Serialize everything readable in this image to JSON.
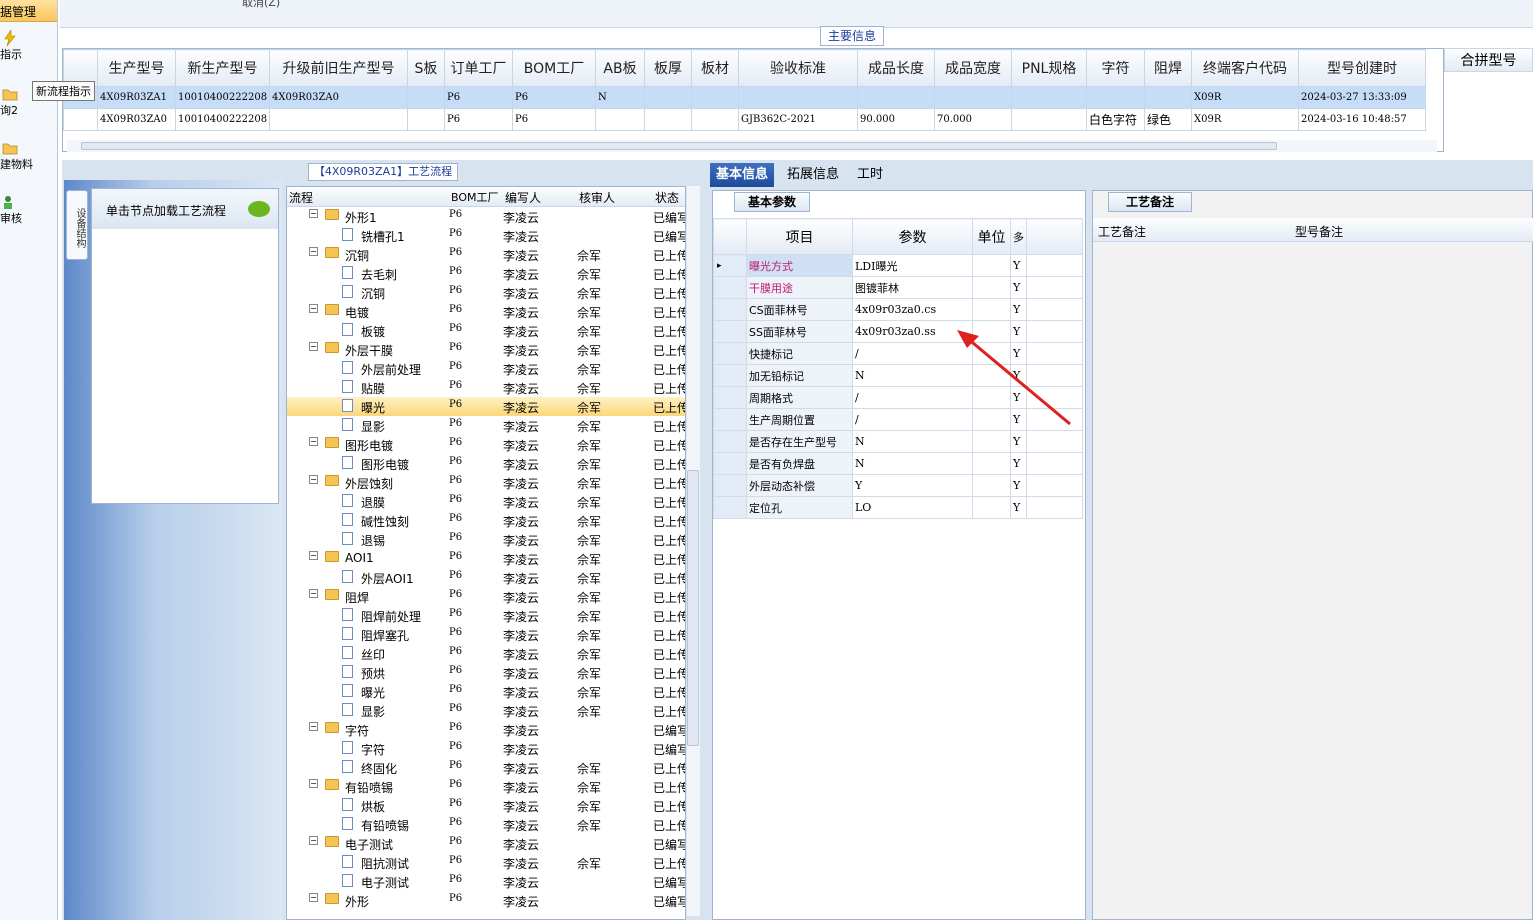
{
  "nav": {
    "header": "据管理",
    "items": [
      {
        "label": "指示",
        "icon": "lightning-icon"
      },
      {
        "label": "询2",
        "icon": "folder-icon"
      },
      {
        "label": "建物料",
        "icon": "folder-icon"
      },
      {
        "label": "审核",
        "icon": "users-icon"
      }
    ],
    "tooltip": "新流程指示"
  },
  "top": {
    "cancel": "取消(Z)"
  },
  "main_info": {
    "legend": "主要信息",
    "columns": [
      "生产型号",
      "新生产型号",
      "升级前旧生产型号",
      "S板",
      "订单工厂",
      "BOM工厂",
      "AB板",
      "板厚",
      "板材",
      "验收标准",
      "成品长度",
      "成品宽度",
      "PNL规格",
      "字符",
      "阻焊",
      "终端客户代码",
      "型号创建时"
    ],
    "combine_header": "合拼型号",
    "rows": [
      [
        "4X09R03ZA1",
        "10010400222208",
        "4X09R03ZA0",
        "",
        "P6",
        "P6",
        "N",
        "",
        "",
        "",
        "",
        "",
        "",
        "",
        "",
        "X09R",
        "2024-03-27 13:33:09"
      ],
      [
        "4X09R03ZA0",
        "10010400222208",
        "",
        "",
        "P6",
        "P6",
        "",
        "",
        "",
        "GJB362C-2021",
        "90.000",
        "70.000",
        "",
        "白色字符",
        "绿色",
        "X09R",
        "2024-03-16 10:48:57"
      ]
    ]
  },
  "left_panel": {
    "vtab": "设备结构",
    "load_hint": "单击节点加载工艺流程"
  },
  "tree": {
    "title": "【4X09R03ZA1】工艺流程",
    "columns": [
      "流程",
      "BOM工厂",
      "编写人",
      "核审人",
      "状态"
    ],
    "rows": [
      {
        "lvl": 0,
        "label": "外形1",
        "bom": "P6",
        "writer": "李凌云",
        "reviewer": "",
        "status": "已编写"
      },
      {
        "lvl": 1,
        "label": "铣槽孔1",
        "bom": "P6",
        "writer": "李凌云",
        "reviewer": "",
        "status": "已编写"
      },
      {
        "lvl": 0,
        "label": "沉铜",
        "bom": "P6",
        "writer": "李凌云",
        "reviewer": "佘军",
        "status": "已上传"
      },
      {
        "lvl": 1,
        "label": "去毛刺",
        "bom": "P6",
        "writer": "李凌云",
        "reviewer": "佘军",
        "status": "已上传"
      },
      {
        "lvl": 1,
        "label": "沉铜",
        "bom": "P6",
        "writer": "李凌云",
        "reviewer": "佘军",
        "status": "已上传"
      },
      {
        "lvl": 0,
        "label": "电镀",
        "bom": "P6",
        "writer": "李凌云",
        "reviewer": "佘军",
        "status": "已上传"
      },
      {
        "lvl": 1,
        "label": "板镀",
        "bom": "P6",
        "writer": "李凌云",
        "reviewer": "佘军",
        "status": "已上传"
      },
      {
        "lvl": 0,
        "label": "外层干膜",
        "bom": "P6",
        "writer": "李凌云",
        "reviewer": "佘军",
        "status": "已上传"
      },
      {
        "lvl": 1,
        "label": "外层前处理",
        "bom": "P6",
        "writer": "李凌云",
        "reviewer": "佘军",
        "status": "已上传"
      },
      {
        "lvl": 1,
        "label": "贴膜",
        "bom": "P6",
        "writer": "李凌云",
        "reviewer": "佘军",
        "status": "已上传"
      },
      {
        "lvl": 1,
        "label": "曝光",
        "bom": "P6",
        "writer": "李凌云",
        "reviewer": "佘军",
        "status": "已上传",
        "hl": true
      },
      {
        "lvl": 1,
        "label": "显影",
        "bom": "P6",
        "writer": "李凌云",
        "reviewer": "佘军",
        "status": "已上传"
      },
      {
        "lvl": 0,
        "label": "图形电镀",
        "bom": "P6",
        "writer": "李凌云",
        "reviewer": "佘军",
        "status": "已上传"
      },
      {
        "lvl": 1,
        "label": "图形电镀",
        "bom": "P6",
        "writer": "李凌云",
        "reviewer": "佘军",
        "status": "已上传"
      },
      {
        "lvl": 0,
        "label": "外层蚀刻",
        "bom": "P6",
        "writer": "李凌云",
        "reviewer": "佘军",
        "status": "已上传"
      },
      {
        "lvl": 1,
        "label": "退膜",
        "bom": "P6",
        "writer": "李凌云",
        "reviewer": "佘军",
        "status": "已上传"
      },
      {
        "lvl": 1,
        "label": "碱性蚀刻",
        "bom": "P6",
        "writer": "李凌云",
        "reviewer": "佘军",
        "status": "已上传"
      },
      {
        "lvl": 1,
        "label": "退锡",
        "bom": "P6",
        "writer": "李凌云",
        "reviewer": "佘军",
        "status": "已上传"
      },
      {
        "lvl": 0,
        "label": "AOI1",
        "bom": "P6",
        "writer": "李凌云",
        "reviewer": "佘军",
        "status": "已上传"
      },
      {
        "lvl": 1,
        "label": "外层AOI1",
        "bom": "P6",
        "writer": "李凌云",
        "reviewer": "佘军",
        "status": "已上传"
      },
      {
        "lvl": 0,
        "label": "阻焊",
        "bom": "P6",
        "writer": "李凌云",
        "reviewer": "佘军",
        "status": "已上传"
      },
      {
        "lvl": 1,
        "label": "阻焊前处理",
        "bom": "P6",
        "writer": "李凌云",
        "reviewer": "佘军",
        "status": "已上传"
      },
      {
        "lvl": 1,
        "label": "阻焊塞孔",
        "bom": "P6",
        "writer": "李凌云",
        "reviewer": "佘军",
        "status": "已上传"
      },
      {
        "lvl": 1,
        "label": "丝印",
        "bom": "P6",
        "writer": "李凌云",
        "reviewer": "佘军",
        "status": "已上传"
      },
      {
        "lvl": 1,
        "label": "预烘",
        "bom": "P6",
        "writer": "李凌云",
        "reviewer": "佘军",
        "status": "已上传"
      },
      {
        "lvl": 1,
        "label": "曝光",
        "bom": "P6",
        "writer": "李凌云",
        "reviewer": "佘军",
        "status": "已上传"
      },
      {
        "lvl": 1,
        "label": "显影",
        "bom": "P6",
        "writer": "李凌云",
        "reviewer": "佘军",
        "status": "已上传"
      },
      {
        "lvl": 0,
        "label": "字符",
        "bom": "P6",
        "writer": "李凌云",
        "reviewer": "",
        "status": "已编写"
      },
      {
        "lvl": 1,
        "label": "字符",
        "bom": "P6",
        "writer": "李凌云",
        "reviewer": "",
        "status": "已编写"
      },
      {
        "lvl": 1,
        "label": "终固化",
        "bom": "P6",
        "writer": "李凌云",
        "reviewer": "佘军",
        "status": "已上传"
      },
      {
        "lvl": 0,
        "label": "有铅喷锡",
        "bom": "P6",
        "writer": "李凌云",
        "reviewer": "佘军",
        "status": "已上传"
      },
      {
        "lvl": 1,
        "label": "烘板",
        "bom": "P6",
        "writer": "李凌云",
        "reviewer": "佘军",
        "status": "已上传"
      },
      {
        "lvl": 1,
        "label": "有铅喷锡",
        "bom": "P6",
        "writer": "李凌云",
        "reviewer": "佘军",
        "status": "已上传"
      },
      {
        "lvl": 0,
        "label": "电子测试",
        "bom": "P6",
        "writer": "李凌云",
        "reviewer": "",
        "status": "已编写"
      },
      {
        "lvl": 1,
        "label": "阻抗测试",
        "bom": "P6",
        "writer": "李凌云",
        "reviewer": "佘军",
        "status": "已上传"
      },
      {
        "lvl": 1,
        "label": "电子测试",
        "bom": "P6",
        "writer": "李凌云",
        "reviewer": "",
        "status": "已编写"
      },
      {
        "lvl": 0,
        "label": "外形",
        "bom": "P6",
        "writer": "李凌云",
        "reviewer": "",
        "status": "已编写"
      }
    ]
  },
  "tabs": [
    "基本信息",
    "拓展信息",
    "工时"
  ],
  "basic": {
    "subtab": "基本参数",
    "columns": [
      "项目",
      "参数",
      "单位",
      "多"
    ],
    "rows": [
      {
        "item": "曝光方式",
        "param": "LDI曝光",
        "unit": "",
        "flag": "Y",
        "pink": true
      },
      {
        "item": "干膜用途",
        "param": "图镀菲林",
        "unit": "",
        "flag": "Y",
        "pink": true
      },
      {
        "item": "CS面菲林号",
        "param": "4x09r03za0.cs",
        "unit": "",
        "flag": "Y"
      },
      {
        "item": "SS面菲林号",
        "param": "4x09r03za0.ss",
        "unit": "",
        "flag": "Y"
      },
      {
        "item": "快捷标记",
        "param": "/",
        "unit": "",
        "flag": "Y"
      },
      {
        "item": "加无铅标记",
        "param": "N",
        "unit": "",
        "flag": "Y"
      },
      {
        "item": "周期格式",
        "param": "/",
        "unit": "",
        "flag": "Y"
      },
      {
        "item": "生产周期位置",
        "param": "/",
        "unit": "",
        "flag": "Y"
      },
      {
        "item": "是否存在生产型号",
        "param": "N",
        "unit": "",
        "flag": "Y"
      },
      {
        "item": "是否有负焊盘",
        "param": "N",
        "unit": "",
        "flag": "Y"
      },
      {
        "item": "外层动态补偿",
        "param": "Y",
        "unit": "",
        "flag": "Y"
      },
      {
        "item": "定位孔",
        "param": "LO",
        "unit": "",
        "flag": "Y"
      }
    ]
  },
  "remark": {
    "tab": "工艺备注",
    "col1": "工艺备注",
    "col2": "型号备注"
  },
  "colors": {
    "accent": "#1d4b9c",
    "pink": "#c2186d",
    "highlight": "#fbd77a",
    "selected": "#c6ddf7",
    "arrow": "#e02020"
  }
}
